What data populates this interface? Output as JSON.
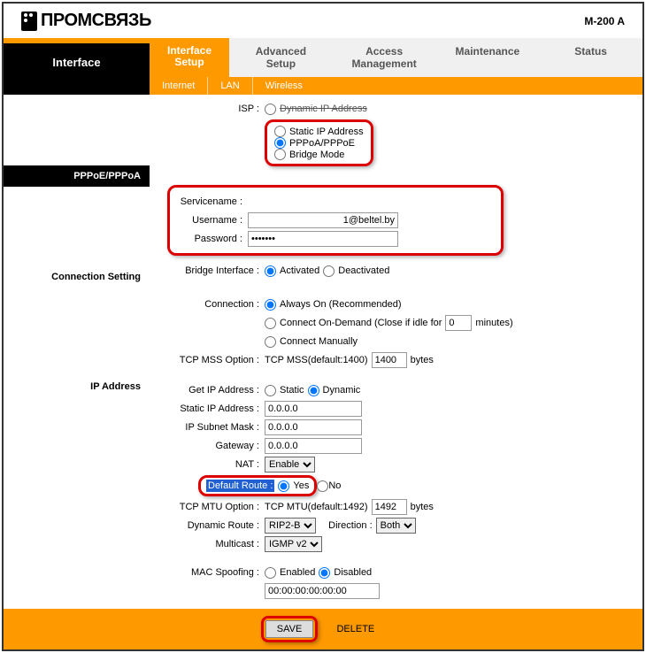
{
  "header": {
    "brand": "ПРОМСВЯЗЬ",
    "model": "M-200 A"
  },
  "nav": {
    "section": "Interface",
    "tabs": [
      "Interface Setup",
      "Advanced Setup",
      "Access Management",
      "Maintenance",
      "Status"
    ],
    "subtabs": [
      "Internet",
      "LAN",
      "Wireless"
    ]
  },
  "side": {
    "pppoe": "PPPoE/PPPoA",
    "conn": "Connection Setting",
    "ip": "IP Address"
  },
  "isp": {
    "label": "ISP :",
    "dynamic": "Dynamic IP Address",
    "static": "Static IP Address",
    "pppoa": "PPPoA/PPPoE",
    "bridge": "Bridge Mode"
  },
  "auth": {
    "servicename": "Servicename :",
    "user_label": "Username :",
    "user_value": "1@beltel.by",
    "pass_label": "Password :",
    "pass_value": "•••••••"
  },
  "bridge": {
    "label": "Bridge Interface :",
    "act": "Activated",
    "deact": "Deactivated"
  },
  "conn": {
    "label": "Connection :",
    "always": "Always On (Recommended)",
    "ondemand_pre": "Connect On-Demand (Close if idle for",
    "ondemand_val": "0",
    "ondemand_post": "minutes)",
    "manual": "Connect Manually",
    "mss_label": "TCP MSS Option :",
    "mss_pre": "TCP MSS(default:1400)",
    "mss_val": "1400",
    "mss_unit": "bytes"
  },
  "ip": {
    "get_label": "Get IP Address :",
    "static": "Static",
    "dynamic": "Dynamic",
    "static_ip_label": "Static IP Address :",
    "static_ip": "0.0.0.0",
    "mask_label": "IP Subnet Mask :",
    "mask": "0.0.0.0",
    "gw_label": "Gateway :",
    "gw": "0.0.0.0",
    "nat_label": "NAT :",
    "nat_val": "Enable",
    "defroute_label": "Default Route :",
    "yes": "Yes",
    "no": "No",
    "mtu_label": "TCP MTU Option :",
    "mtu_pre": "TCP MTU(default:1492)",
    "mtu_val": "1492",
    "mtu_unit": "bytes",
    "dynroute_label": "Dynamic Route :",
    "dynroute_val": "RIP2-B",
    "dir_label": "Direction :",
    "dir_val": "Both",
    "multicast_label": "Multicast :",
    "multicast_val": "IGMP v2",
    "mac_label": "MAC Spoofing :",
    "enabled": "Enabled",
    "disabled": "Disabled",
    "mac_val": "00:00:00:00:00:00"
  },
  "footer": {
    "save": "SAVE",
    "delete": "DELETE"
  }
}
